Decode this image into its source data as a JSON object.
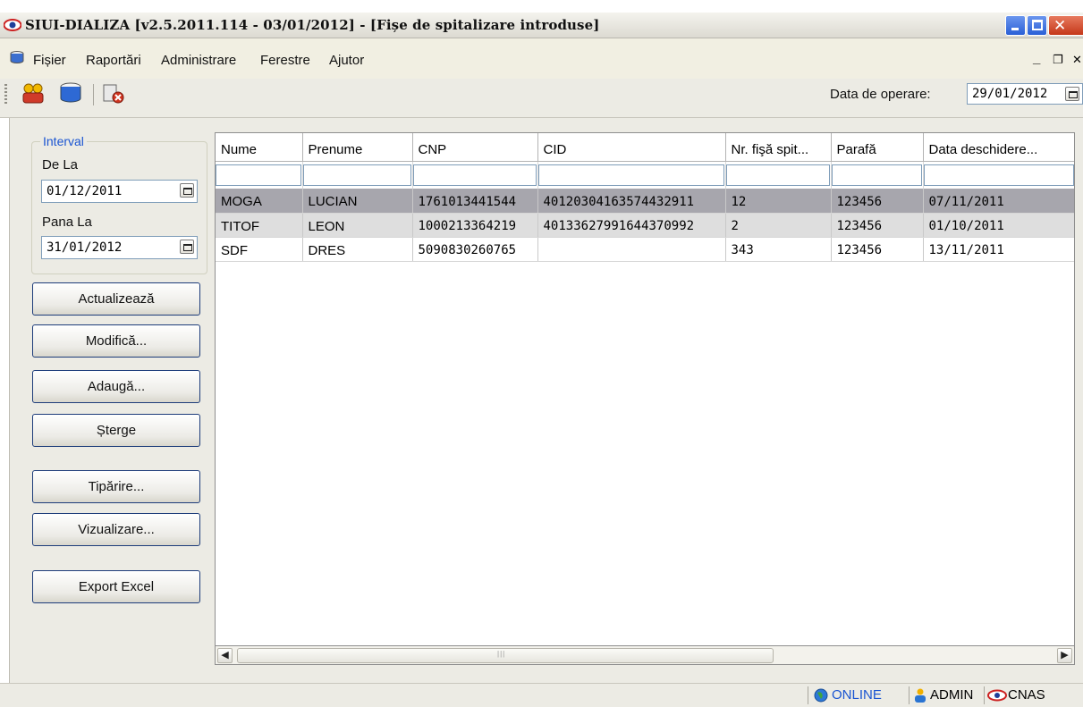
{
  "window": {
    "title": "SIUI-DIALIZA [v2.5.2011.114 - 03/01/2012] - [Fișe de spitalizare introduse]"
  },
  "menu": {
    "items": [
      "Fișier",
      "Raportări",
      "Administrare",
      "Ferestre",
      "Ajutor"
    ],
    "mdi_min": "_",
    "mdi_restore": "❐",
    "mdi_close": "✕"
  },
  "toolbar": {
    "icons": [
      "patients-icon",
      "database-icon",
      "exit-icon"
    ],
    "operation_date_label": "Data de operare:",
    "operation_date": "29/01/2012"
  },
  "interval": {
    "legend": "Interval",
    "from_label": "De La",
    "from_value": "01/12/2011",
    "to_label": "Pana La",
    "to_value": "31/01/2012"
  },
  "buttons": {
    "refresh": "Actualizează",
    "modify": "Modifică...",
    "add": "Adaugă...",
    "delete": "Șterge",
    "print": "Tipărire...",
    "preview": "Vizualizare...",
    "export": "Export Excel"
  },
  "grid": {
    "columns": [
      "Nume",
      "Prenume",
      "CNP",
      "CID",
      "Nr. fişă spit...",
      "Parafă",
      "Data deschidere..."
    ],
    "rows": [
      [
        "MOGA",
        "LUCIAN",
        "1761013441544",
        "40120304163574432911",
        "12",
        "123456",
        "07/11/2011"
      ],
      [
        "TITOF",
        "LEON",
        "1000213364219",
        "40133627991644370992",
        "2",
        "123456",
        "01/10/2011"
      ],
      [
        "SDF",
        "DRES",
        "5090830260765",
        "",
        "343",
        "123456",
        "13/11/2011"
      ]
    ]
  },
  "status": {
    "online": "ONLINE",
    "user": "ADMIN",
    "cnas": "CNAS"
  },
  "colors": {
    "selected_row": "#a7a6ad",
    "alt_row": "#dedede",
    "accent": "#1a55d2"
  }
}
